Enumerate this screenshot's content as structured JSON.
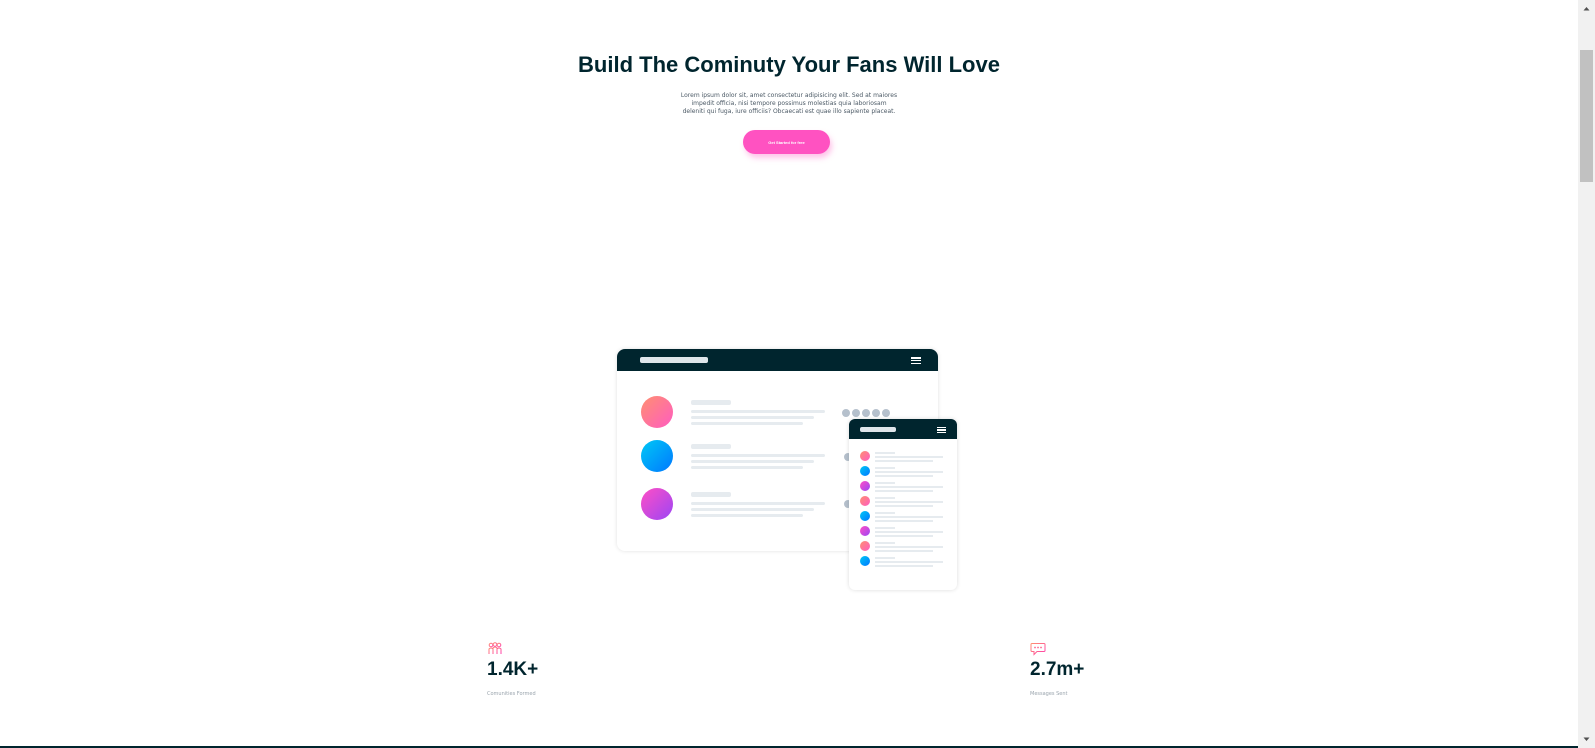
{
  "hero": {
    "title": "Build The Cominuty Your Fans Will Love",
    "text": "Lorem ipsum dolor sit, amet consectetur adipisicing elit. Sed at maiores impedit officia, nisi tempore possimus molestias quia laboriosam deleniti qui fuga, iure officiis? Obcaecati est quae illo sapiente placeat.",
    "cta_label": "Get Started for free"
  },
  "colors": {
    "accent": "#ff52c1",
    "dark": "#00252e",
    "gradient_orange": "#ff8f70",
    "gradient_blue": "#0078ff",
    "gradient_purple": "#9c45f5"
  },
  "stats": [
    {
      "icon": "communities-icon",
      "value": "1.4K+",
      "label": "Comunities Formed"
    },
    {
      "icon": "messages-icon",
      "value": "2.7m+",
      "label": "Messages Sent"
    }
  ]
}
